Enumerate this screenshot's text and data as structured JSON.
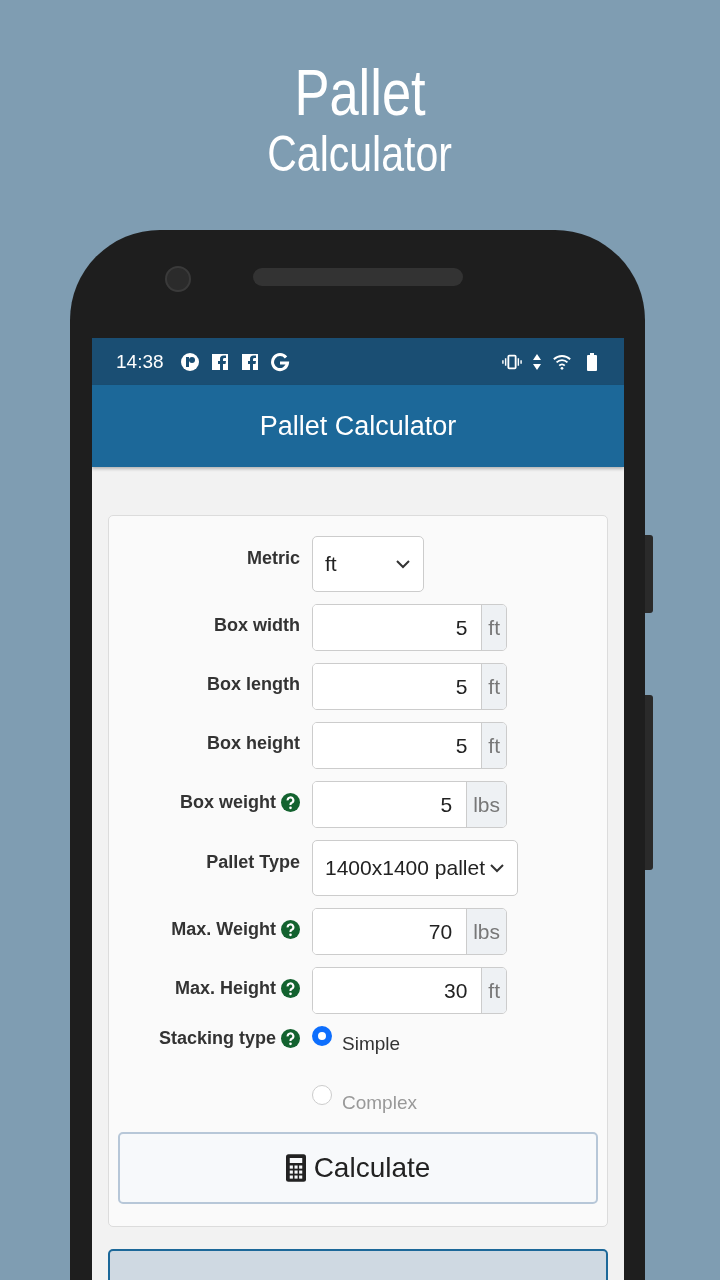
{
  "headline": {
    "line_1": "Pallet",
    "line_2": "Calculator"
  },
  "status_bar": {
    "time": "14:38"
  },
  "app_bar": {
    "title": "Pallet Calculator"
  },
  "form": {
    "fields": [
      {
        "kind": "select",
        "label": "Metric",
        "value": "ft",
        "help": false
      },
      {
        "kind": "input",
        "label": "Box width",
        "value": "5",
        "unit": "ft",
        "help": false
      },
      {
        "kind": "input",
        "label": "Box length",
        "value": "5",
        "unit": "ft",
        "help": false
      },
      {
        "kind": "input",
        "label": "Box height",
        "value": "5",
        "unit": "ft",
        "help": false
      },
      {
        "kind": "input",
        "label": "Box weight",
        "value": "5",
        "unit": "lbs",
        "help": true
      },
      {
        "kind": "select",
        "label": "Pallet Type",
        "value": "1400x1400 pallet",
        "help": false
      },
      {
        "kind": "input",
        "label": "Max. Weight",
        "value": "70",
        "unit": "lbs",
        "help": true
      },
      {
        "kind": "input",
        "label": "Max. Height",
        "value": "30",
        "unit": "ft",
        "help": true
      },
      {
        "kind": "radio",
        "label": "Stacking type",
        "help": true,
        "options": [
          {
            "label": "Simple",
            "selected": true
          },
          {
            "label": "Complex",
            "selected": false
          }
        ]
      }
    ],
    "button": "Calculate"
  }
}
